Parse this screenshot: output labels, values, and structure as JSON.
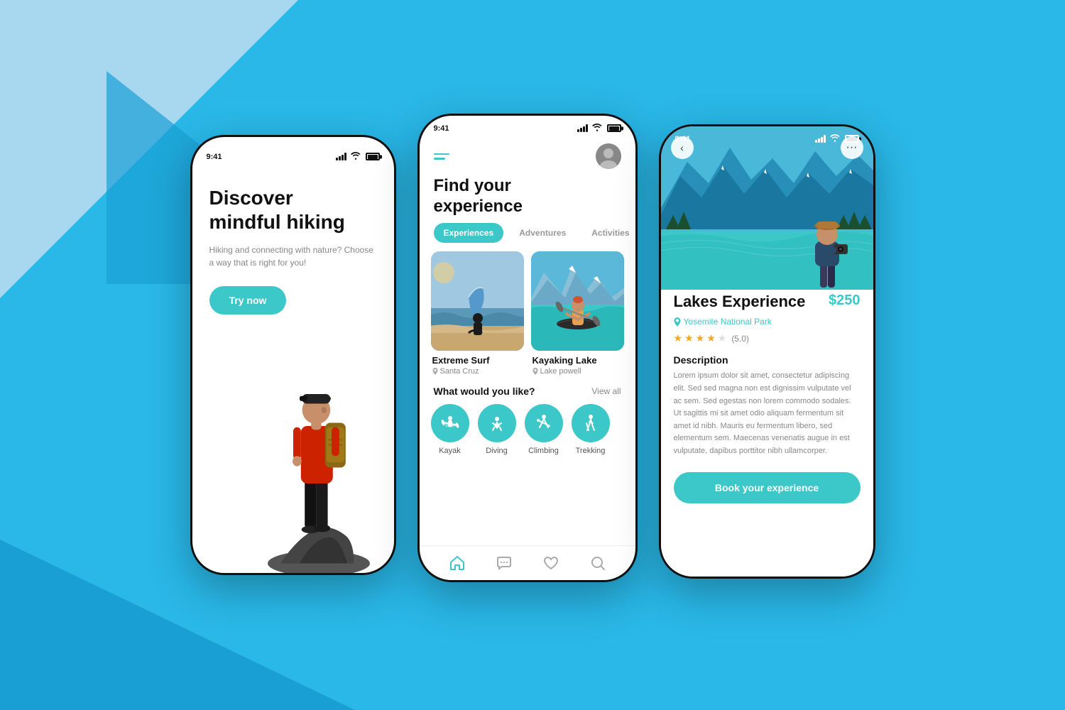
{
  "background": {
    "color": "#29b8e8"
  },
  "phone1": {
    "status_time": "9:41",
    "title_line1": "Discover",
    "title_line2": "mindful hiking",
    "subtitle": "Hiking and connecting with nature? Choose a way that is right for you!",
    "cta_button": "Try now"
  },
  "phone2": {
    "status_time": "9:41",
    "heading_line1": "Find your",
    "heading_line2": "experience",
    "tabs": [
      "Experiences",
      "Adventures",
      "Activities"
    ],
    "active_tab": 0,
    "card1": {
      "title": "Extreme Surf",
      "location": "Santa Cruz"
    },
    "card2": {
      "title": "Kayaking Lake",
      "location": "Lake powell"
    },
    "section_title": "What would you like?",
    "view_all": "View all",
    "activities": [
      "Kayak",
      "Diving",
      "Climbing",
      "Trekking"
    ]
  },
  "phone3": {
    "status_time": "9:41",
    "title": "Lakes Experience",
    "price": "$250",
    "location": "Yosemite National Park",
    "rating": 5.0,
    "stars_filled": 4,
    "stars_empty": 1,
    "rating_label": "(5.0)",
    "description_heading": "Description",
    "description": "Lorem ipsum dolor sit amet, consectetur adipiscing elit. Sed sed magna non est dignissim vulputate vel ac sem. Sed egestas non lorem commodo sodales. Ut sagittis mi sit amet odio aliquam fermentum sit amet id nibh. Mauris eu fermentum libero, sed elementum sem. Maecenas venenatis augue in est vulputate, dapibus porttitor nibh ullamcorper.",
    "book_button": "Book your experience"
  }
}
